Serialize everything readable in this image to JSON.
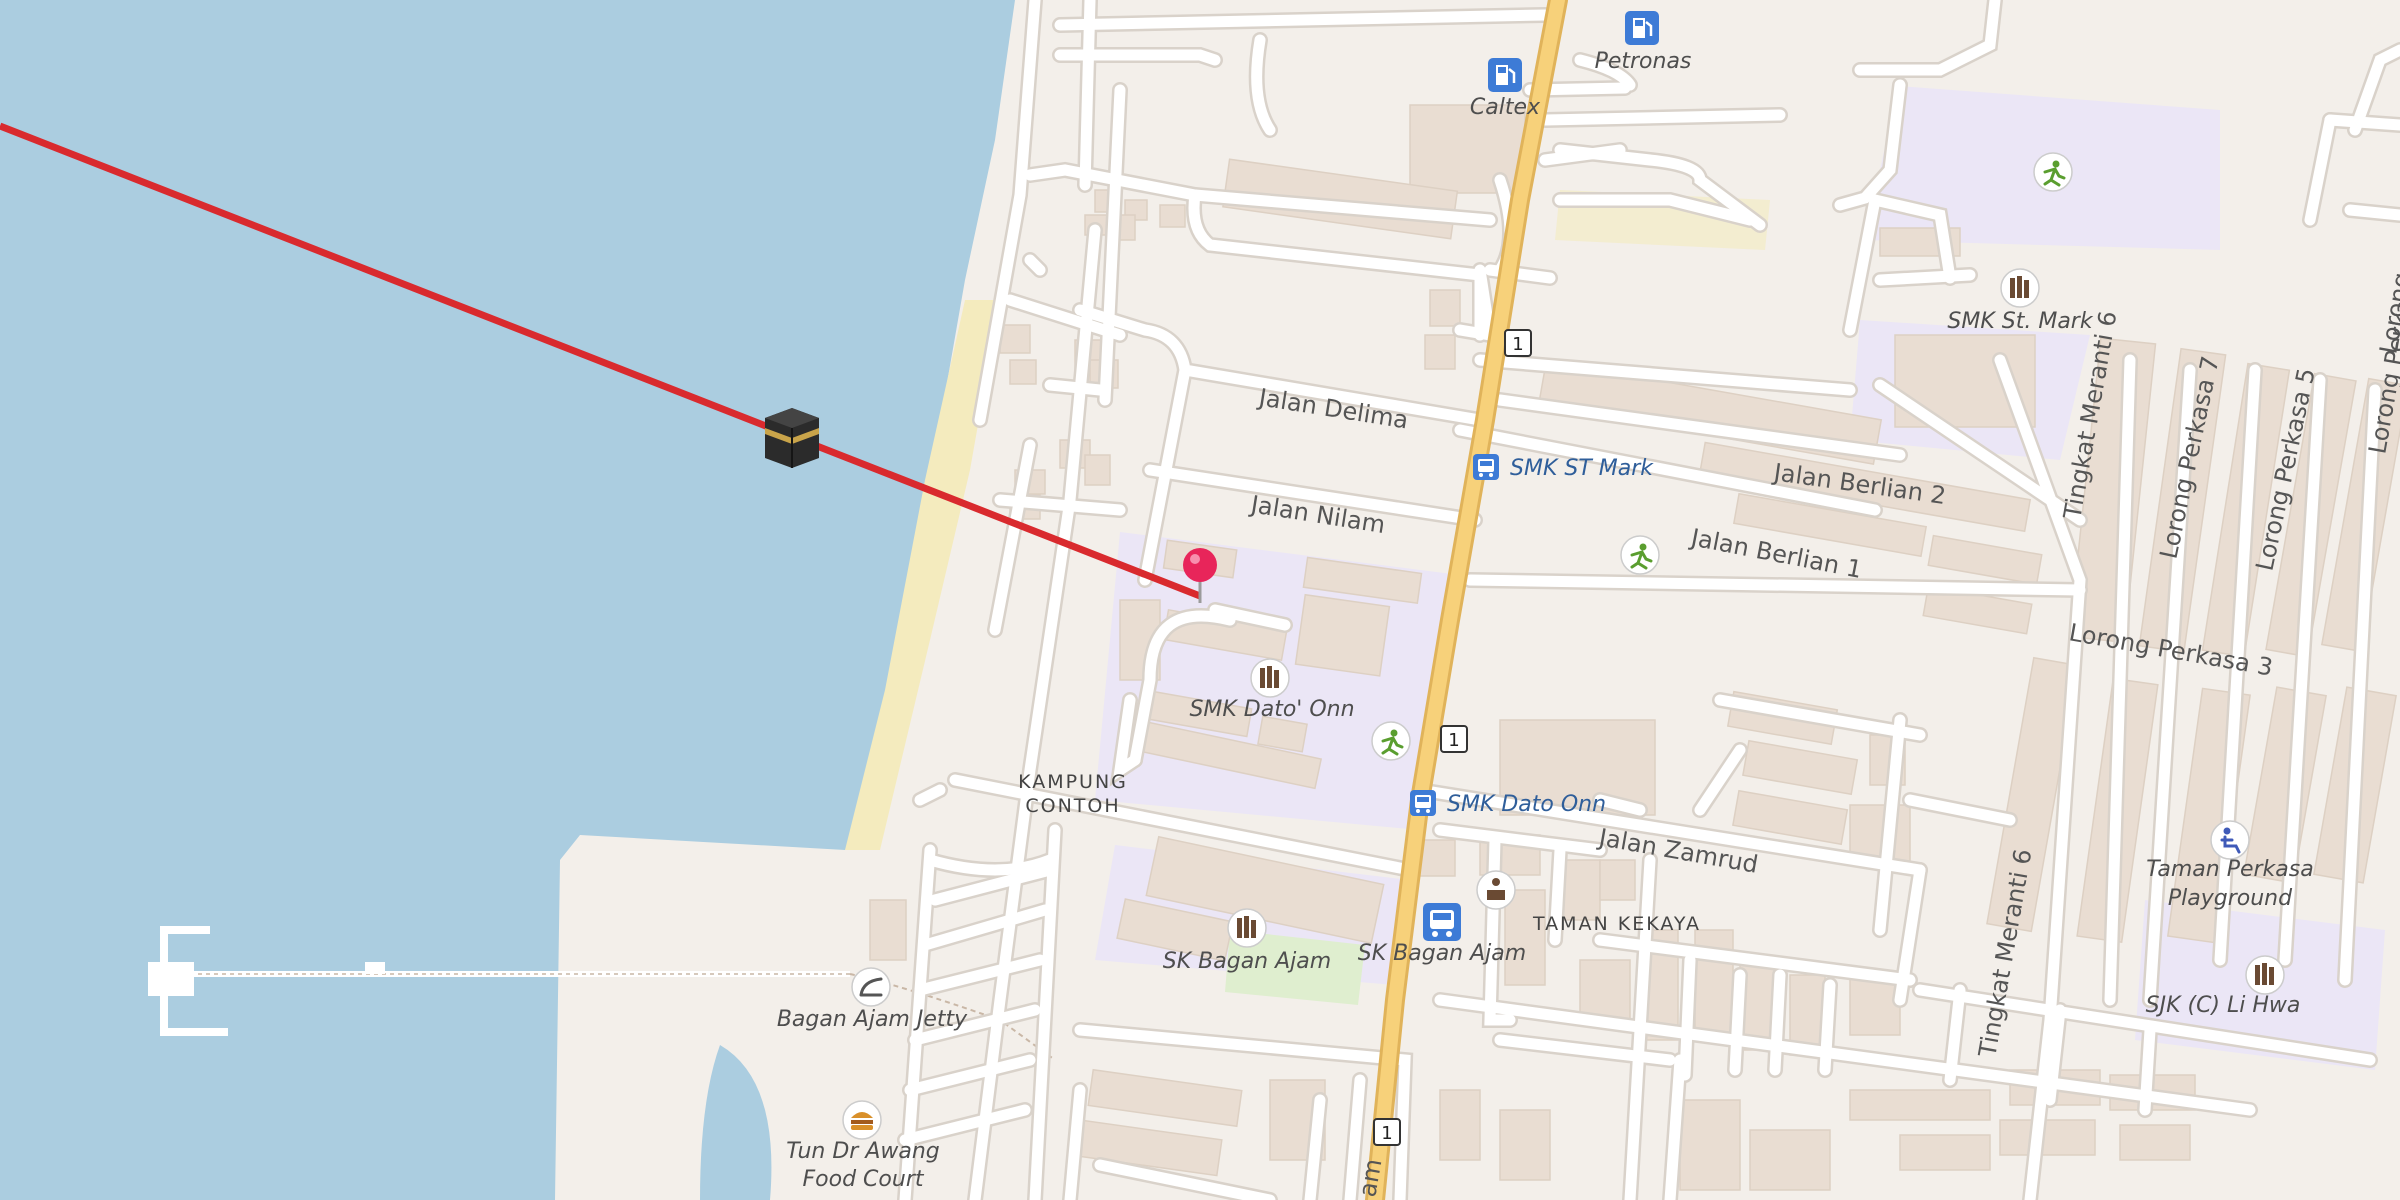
{
  "map": {
    "colors": {
      "water": "#abcde0",
      "land": "#f3efea",
      "sand": "#f4ebbe",
      "school": "#ebe6f6",
      "building": "#e9ddd2",
      "road": "#ffffff",
      "trunk": "#f7d17a",
      "route_line": "#d92a2e",
      "pin": "#e8255a",
      "bus": "#3d7bd6",
      "fuel": "#3d7bd6",
      "park": "#dfeecf"
    },
    "route_badges": [
      "1",
      "1",
      "1"
    ],
    "streets": {
      "jalan_delima": "Jalan Delima",
      "jalan_nilam": "Jalan Nilam",
      "jalan_berlian_2": "Jalan Berlian 2",
      "jalan_berlian_1": "Jalan Berlian 1",
      "jalan_zamrud": "Jalan Zamrud",
      "lorong_perkasa_3": "Lorong Perkasa 3",
      "lorong_perkasa_7": "Lorong Perkasa 7",
      "lorong_perkasa_5": "Lorong Perkasa 5",
      "lorong_perkasa_edge": "Lorong Perka",
      "lorong_edge_2": "Lorong",
      "tingkat_meranti_6_top": "Tingkat Meranti 6",
      "tingkat_meranti_6_bottom": "Tingkat Meranti 6",
      "trunk_road_fragment": "am"
    },
    "places": {
      "petronas": "Petronas",
      "caltex": "Caltex",
      "smk_st_mark": "SMK St. Mark",
      "smk_st_mark_bus": "SMK ST Mark",
      "smk_dato_onn": "SMK Dato' Onn",
      "smk_dato_onn_bus": "SMK Dato Onn",
      "kampung_line1": "KAMPUNG",
      "kampung_line2": "CONTOH",
      "taman_kekaya": "TAMAN KEKAYA",
      "sk_bagan_ajam": "SK Bagan Ajam",
      "sk_bagan_ajam_bus": "SK Bagan Ajam",
      "taman_perkasa_line1": "Taman Perkasa",
      "taman_perkasa_line2": "Playground",
      "sjk_li_hwa": "SJK (C) Li Hwa",
      "bagan_ajam_jetty": "Bagan Ajam Jetty",
      "food_court_line1": "Tun Dr Awang",
      "food_court_line2": "Food Court"
    },
    "qibla_line": {
      "icon": "kaaba-icon"
    },
    "location_pin": {
      "icon": "map-pin-icon"
    }
  }
}
